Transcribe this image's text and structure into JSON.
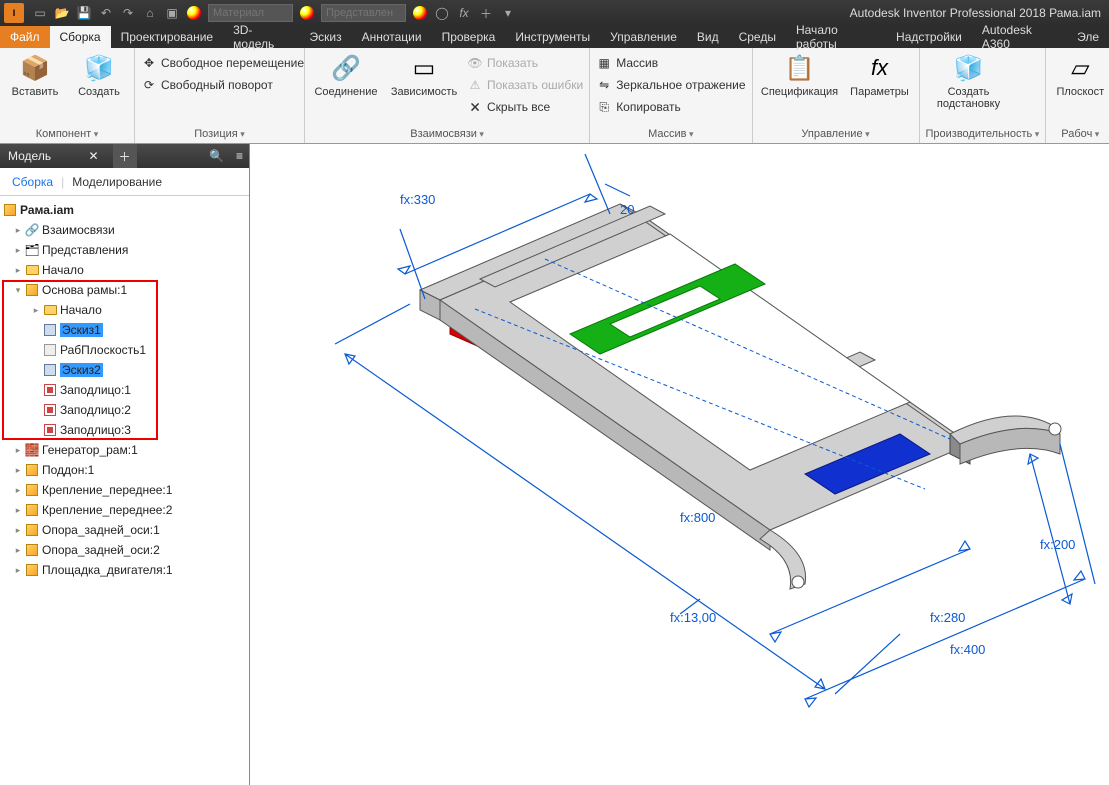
{
  "app": {
    "title": "Autodesk Inventor Professional 2018   Рама.iam"
  },
  "qat": {
    "combo1_placeholder": "Материал",
    "combo2_placeholder": "Представлен",
    "fx": "fx"
  },
  "tabs": {
    "file": "Файл",
    "items": [
      "Сборка",
      "Проектирование",
      "3D-модель",
      "Эскиз",
      "Аннотации",
      "Проверка",
      "Инструменты",
      "Управление",
      "Вид",
      "Среды",
      "Начало работы",
      "Надстройки",
      "Autodesk A360",
      "Эле"
    ]
  },
  "ribbon": {
    "component": {
      "insert": "Вставить",
      "create": "Создать",
      "label": "Компонент"
    },
    "position": {
      "free_move": "Свободное перемещение",
      "free_rotate": "Свободный поворот",
      "label": "Позиция"
    },
    "relations": {
      "connect": "Соединение",
      "constrain": "Зависимость",
      "show": "Показать",
      "show_errors": "Показать ошибки",
      "hide_all": "Скрыть все",
      "label": "Взаимосвязи"
    },
    "pattern": {
      "array": "Массив",
      "mirror": "Зеркальное отражение",
      "copy": "Копировать",
      "label": "Массив"
    },
    "manage": {
      "bom": "Спецификация",
      "params": "Параметры",
      "label": "Управление"
    },
    "productivity": {
      "substitute": "Создать подстановку",
      "label": "Производительность"
    },
    "workfeat": {
      "plane": "Плоскост",
      "label": "Рабоч"
    }
  },
  "panel": {
    "title": "Модель",
    "tab1": "Сборка",
    "tab2": "Моделирование",
    "root": "Рама.iam",
    "nodes": {
      "rel": "Взаимосвязи",
      "repr": "Представления",
      "origin": "Начало",
      "base": "Основа рамы:1",
      "base_origin": "Начало",
      "sk1": "Эскиз1",
      "wp1": "РабПлоскость1",
      "sk2": "Эскиз2",
      "f1": "Заподлицо:1",
      "f2": "Заподлицо:2",
      "f3": "Заподлицо:3",
      "gen": "Генератор_рам:1",
      "pallet": "Поддон:1",
      "fr1": "Крепление_переднее:1",
      "fr2": "Крепление_переднее:2",
      "ra1": "Опора_задней_оси:1",
      "ra2": "Опора_задней_оси:2",
      "eng": "Площадка_двигателя:1"
    }
  },
  "dims": {
    "d330": "fx:330",
    "d20": "20",
    "d800": "fx:800",
    "d13": "fx:13,00",
    "d280": "fx:280",
    "d200": "fx:200",
    "d400": "fx:400"
  }
}
